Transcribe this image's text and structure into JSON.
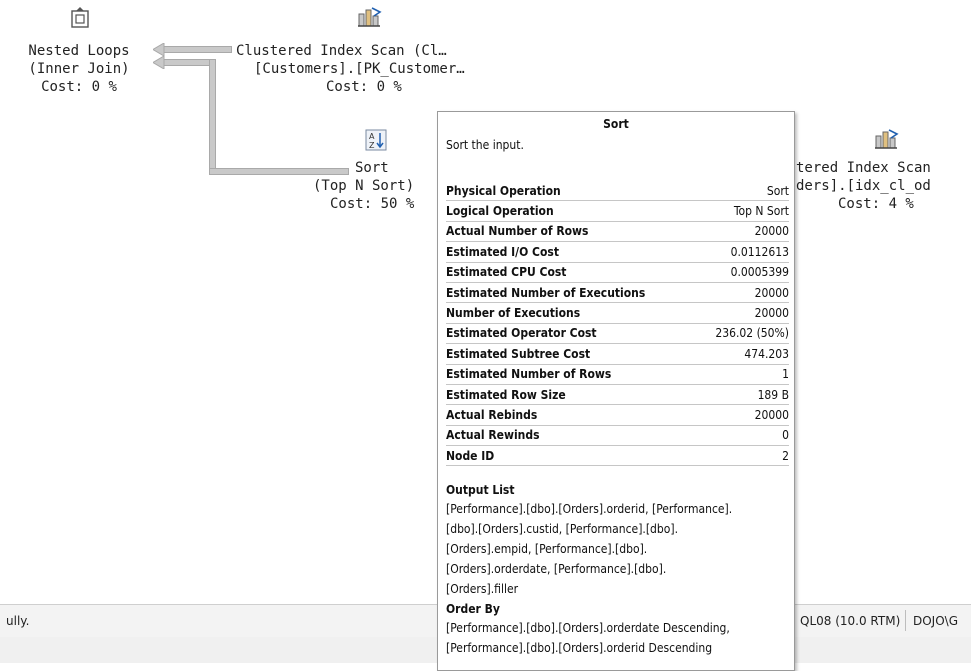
{
  "plan": {
    "nested_loops": {
      "icon": "nested-loops-icon",
      "line1": "Nested Loops",
      "line2": "(Inner Join)",
      "line3": "Cost: 0 %"
    },
    "customers_scan": {
      "icon": "clustered-index-scan-icon",
      "line1": "Clustered Index Scan (Cl…",
      "line2": "[Customers].[PK_Customer…",
      "line3": "Cost: 0 %"
    },
    "sort": {
      "icon": "sort-icon",
      "line1": "Sort",
      "line2": "(Top N Sort)",
      "line3": "Cost: 50 %"
    },
    "orders_scan": {
      "icon": "clustered-index-scan-icon",
      "line1": "tered Index Scan",
      "line2": "ders].[idx_cl_od",
      "line3": "Cost: 4 %"
    }
  },
  "tooltip": {
    "title": "Sort",
    "description": "Sort the input.",
    "properties": [
      {
        "label": "Physical Operation",
        "value": "Sort"
      },
      {
        "label": "Logical Operation",
        "value": "Top N Sort"
      },
      {
        "label": "Actual Number of Rows",
        "value": "20000"
      },
      {
        "label": "Estimated I/O Cost",
        "value": "0.0112613"
      },
      {
        "label": "Estimated CPU Cost",
        "value": "0.0005399"
      },
      {
        "label": "Estimated Number of Executions",
        "value": "20000"
      },
      {
        "label": "Number of Executions",
        "value": "20000"
      },
      {
        "label": "Estimated Operator Cost",
        "value": "236.02 (50%)"
      },
      {
        "label": "Estimated Subtree Cost",
        "value": "474.203"
      },
      {
        "label": "Estimated Number of Rows",
        "value": "1"
      },
      {
        "label": "Estimated Row Size",
        "value": "189 B"
      },
      {
        "label": "Actual Rebinds",
        "value": "20000"
      },
      {
        "label": "Actual Rewinds",
        "value": "0"
      },
      {
        "label": "Node ID",
        "value": "2"
      }
    ],
    "output_list": {
      "heading": "Output List",
      "lines": [
        "[Performance].[dbo].[Orders].orderid, [Performance].",
        "[dbo].[Orders].custid, [Performance].[dbo].",
        "[Orders].empid, [Performance].[dbo].",
        "[Orders].orderdate, [Performance].[dbo].",
        "[Orders].filler"
      ]
    },
    "order_by": {
      "heading": "Order By",
      "lines": [
        "[Performance].[dbo].[Orders].orderdate Descending,",
        "[Performance].[dbo].[Orders].orderid Descending"
      ]
    }
  },
  "statusbar": {
    "message": "ully.",
    "server": "QL08 (10.0 RTM)",
    "user": "DOJO\\G"
  }
}
